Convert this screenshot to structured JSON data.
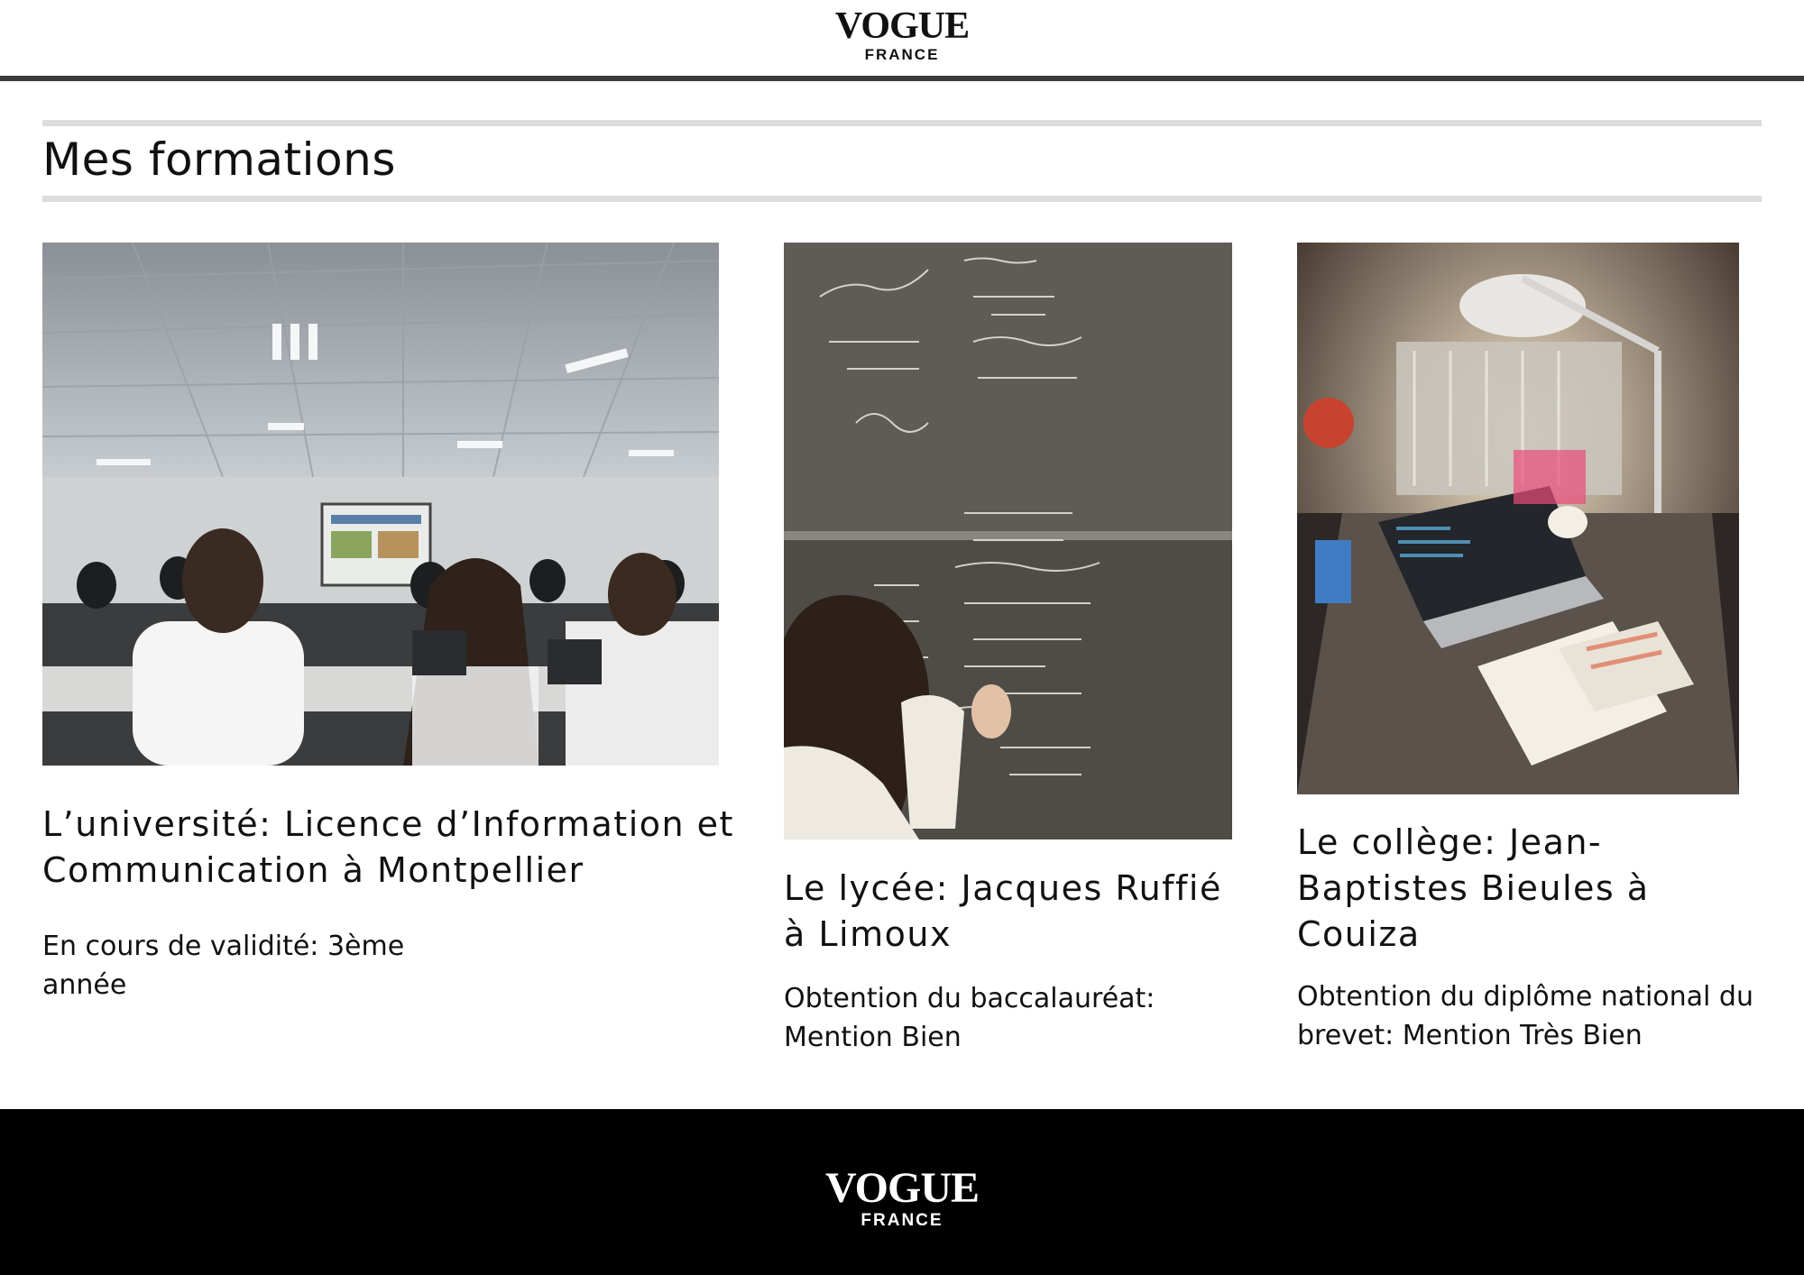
{
  "header": {
    "logo_main": "VOGUE",
    "logo_sub": "FRANCE"
  },
  "section": {
    "title": "Mes formations"
  },
  "cards": [
    {
      "title": "L’université: Licence d’Information et Communication à Montpellier",
      "description": "En cours de validité: 3ème année"
    },
    {
      "title": "Le lycée: Jacques Ruffié à Limoux",
      "description": "Obtention du baccalauréat: Mention Bien"
    },
    {
      "title": "Le collège: Jean-Baptistes Bieules à Couiza",
      "description": "Obtention du diplôme national du brevet: Mention Très Bien"
    }
  ],
  "footer": {
    "logo_main": "VOGUE",
    "logo_sub": "FRANCE"
  },
  "colors": {
    "header_rule": "#3b3b3b",
    "section_rule": "#dddddd",
    "footer_bg": "#000000",
    "text": "#111111"
  }
}
